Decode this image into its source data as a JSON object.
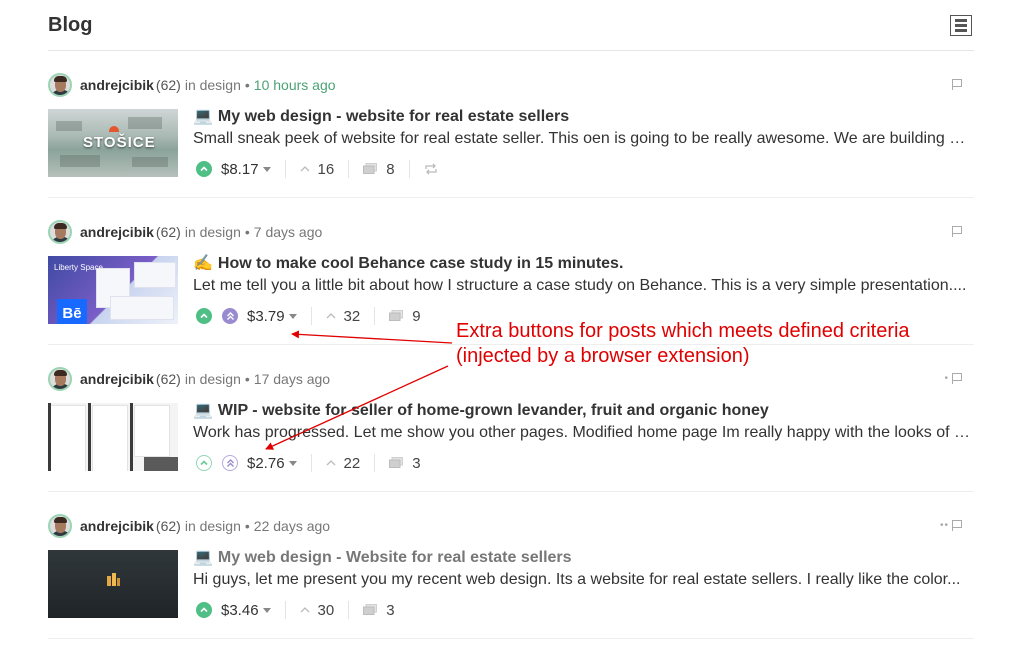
{
  "header": {
    "title": "Blog"
  },
  "posts": [
    {
      "author": "andrejcibik",
      "reputation": "(62)",
      "community": "in design",
      "sep": "•",
      "time": "10 hours ago",
      "time_new": true,
      "flag_dots": "",
      "emoji": "💻",
      "title": "My web design - website for real estate sellers",
      "title_muted": false,
      "summary": "Small sneak peek of website for real estate seller. This oen is going to be really awesome. We are building a...",
      "payout": "$8.17",
      "votes": "16",
      "comments": "8",
      "upvoted": true,
      "ext_button": false,
      "ext_active": false,
      "reblog": true,
      "thumb_text": "STOŠICE"
    },
    {
      "author": "andrejcibik",
      "reputation": "(62)",
      "community": "in design",
      "sep": "•",
      "time": "7 days ago",
      "time_new": false,
      "flag_dots": "",
      "emoji": "✍",
      "title": "How to make cool Behance case study in 15 minutes.",
      "title_muted": false,
      "summary": "Let me tell you a little bit about how I structure a case study on Behance. This is a very simple presentation....",
      "payout": "$3.79",
      "votes": "32",
      "comments": "9",
      "upvoted": true,
      "ext_button": true,
      "ext_active": true,
      "reblog": false,
      "thumb_text": "Bē"
    },
    {
      "author": "andrejcibik",
      "reputation": "(62)",
      "community": "in design",
      "sep": "•",
      "time": "17 days ago",
      "time_new": false,
      "flag_dots": "•",
      "emoji": "💻",
      "title": "WIP - website for seller of home-grown levander, fruit and organic honey",
      "title_muted": false,
      "summary": "Work has progressed. Let me show you other pages. Modified home page Im really happy with the looks of it. O...",
      "payout": "$2.76",
      "votes": "22",
      "comments": "3",
      "upvoted": false,
      "ext_button": true,
      "ext_active": false,
      "reblog": false,
      "thumb_text": ""
    },
    {
      "author": "andrejcibik",
      "reputation": "(62)",
      "community": "in design",
      "sep": "•",
      "time": "22 days ago",
      "time_new": false,
      "flag_dots": "••",
      "emoji": "💻",
      "title": "My web design - Website for real estate sellers",
      "title_muted": true,
      "summary": "Hi guys, let me present you my recent web design. Its a website for real estate sellers. I really like the color...",
      "payout": "$3.46",
      "votes": "30",
      "comments": "3",
      "upvoted": true,
      "ext_button": false,
      "ext_active": false,
      "reblog": false,
      "thumb_text": ""
    }
  ],
  "annotation": {
    "line1": "Extra buttons for posts which meets defined criteria",
    "line2": "(injected by a browser extension)",
    "color": "#e00000"
  },
  "colors": {
    "upvote": "#4fbf86",
    "extension": "#9a8bd0",
    "new_time": "#4ba274"
  },
  "icons": [
    "flag-icon",
    "upvote-icon",
    "extension-icon",
    "caret-down-icon",
    "chevron-up-icon",
    "comment-icon",
    "reblog-icon",
    "layout-toggle-icon"
  ]
}
